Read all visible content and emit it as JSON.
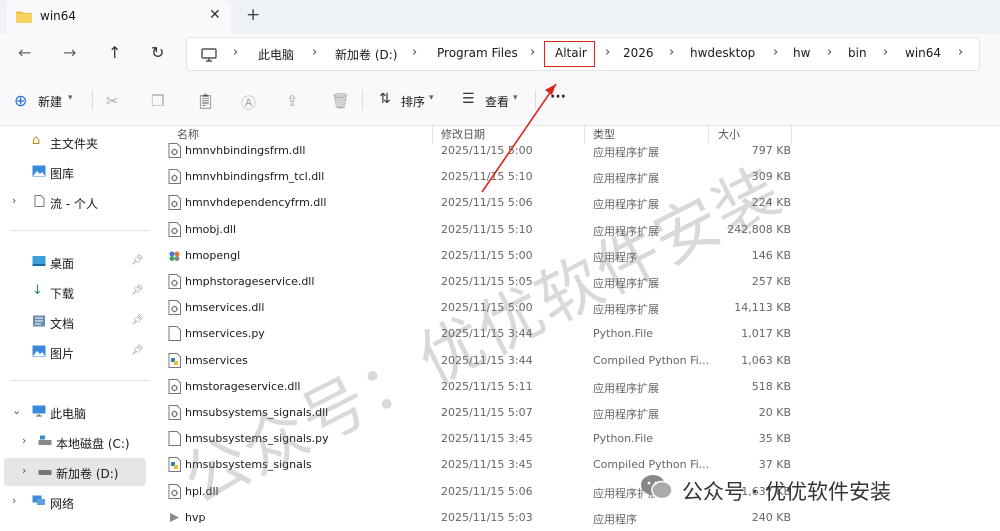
{
  "window": {
    "tab_title": "win64",
    "close_label": "✕",
    "new_tab_label": "+"
  },
  "nav": {
    "back": "←",
    "forward": "→",
    "up": "↑",
    "refresh": "↻"
  },
  "breadcrumb": [
    {
      "label": "此电脑"
    },
    {
      "label": "新加卷 (D:)"
    },
    {
      "label": "Program Files"
    },
    {
      "label": "Altair"
    },
    {
      "label": "2026"
    },
    {
      "label": "hwdesktop"
    },
    {
      "label": "hw"
    },
    {
      "label": "bin"
    },
    {
      "label": "win64"
    }
  ],
  "toolbar": {
    "new_label": "新建",
    "sort_label": "排序",
    "view_label": "查看",
    "more_label": "···"
  },
  "sidebar": {
    "items": [
      {
        "label": "主文件夹"
      },
      {
        "label": "图库"
      },
      {
        "label": "流 - 个人"
      },
      {
        "label": "桌面"
      },
      {
        "label": "下载"
      },
      {
        "label": "文档"
      },
      {
        "label": "图片"
      },
      {
        "label": "此电脑"
      },
      {
        "label": "本地磁盘 (C:)"
      },
      {
        "label": "新加卷 (D:)"
      },
      {
        "label": "网络"
      }
    ]
  },
  "columns": {
    "name": "名称",
    "date": "修改日期",
    "type": "类型",
    "size": "大小"
  },
  "files": [
    {
      "name": "hmnvhbindingsfrm.dll",
      "date": "2025/11/15 5:00",
      "type": "应用程序扩展",
      "size": "797 KB",
      "icon": "dll"
    },
    {
      "name": "hmnvhbindingsfrm_tcl.dll",
      "date": "2025/11/15 5:10",
      "type": "应用程序扩展",
      "size": "309 KB",
      "icon": "dll"
    },
    {
      "name": "hmnvhdependencyfrm.dll",
      "date": "2025/11/15 5:06",
      "type": "应用程序扩展",
      "size": "224 KB",
      "icon": "dll"
    },
    {
      "name": "hmobj.dll",
      "date": "2025/11/15 5:10",
      "type": "应用程序扩展",
      "size": "242,808 KB",
      "icon": "dll"
    },
    {
      "name": "hmopengl",
      "date": "2025/11/15 5:00",
      "type": "应用程序",
      "size": "146 KB",
      "icon": "exe"
    },
    {
      "name": "hmphstorageservice.dll",
      "date": "2025/11/15 5:05",
      "type": "应用程序扩展",
      "size": "257 KB",
      "icon": "dll"
    },
    {
      "name": "hmservices.dll",
      "date": "2025/11/15 5:00",
      "type": "应用程序扩展",
      "size": "14,113 KB",
      "icon": "dll"
    },
    {
      "name": "hmservices.py",
      "date": "2025/11/15 3:44",
      "type": "Python.File",
      "size": "1,017 KB",
      "icon": "file"
    },
    {
      "name": "hmservices",
      "date": "2025/11/15 3:44",
      "type": "Compiled Python Fi...",
      "size": "1,063 KB",
      "icon": "pyc"
    },
    {
      "name": "hmstorageservice.dll",
      "date": "2025/11/15 5:11",
      "type": "应用程序扩展",
      "size": "518 KB",
      "icon": "dll"
    },
    {
      "name": "hmsubsystems_signals.dll",
      "date": "2025/11/15 5:07",
      "type": "应用程序扩展",
      "size": "20 KB",
      "icon": "dll"
    },
    {
      "name": "hmsubsystems_signals.py",
      "date": "2025/11/15 3:45",
      "type": "Python.File",
      "size": "35 KB",
      "icon": "file"
    },
    {
      "name": "hmsubsystems_signals",
      "date": "2025/11/15 3:45",
      "type": "Compiled Python Fi...",
      "size": "37 KB",
      "icon": "pyc"
    },
    {
      "name": "hpl.dll",
      "date": "2025/11/15 5:06",
      "type": "应用程序扩展",
      "size": "1,637 KB",
      "icon": "dll"
    },
    {
      "name": "hvp",
      "date": "2025/11/15 5:03",
      "type": "应用程序",
      "size": "240 KB",
      "icon": "exe2"
    }
  ],
  "watermark": {
    "main": "公众号：优优软件安装",
    "badge": "公众号 · 优优软件安装"
  },
  "colors": {
    "highlight": "#d9251d",
    "folder": "#f0c040",
    "accent": "#1f6fd0"
  }
}
